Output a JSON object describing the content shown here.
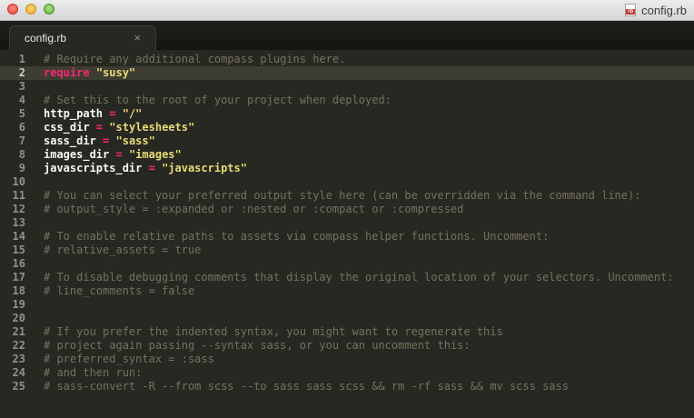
{
  "window": {
    "title": "config.rb",
    "file_icon_text": "rb"
  },
  "tabs": [
    {
      "label": "config.rb",
      "close": "×",
      "active": true
    }
  ],
  "editor": {
    "current_line": 2,
    "lines": [
      {
        "n": "1",
        "tokens": [
          {
            "t": "comment",
            "v": "# Require any additional compass plugins here."
          }
        ]
      },
      {
        "n": "2",
        "tokens": [
          {
            "t": "keyword",
            "v": "require"
          },
          {
            "t": "plain",
            "v": " "
          },
          {
            "t": "string",
            "v": "\"susy\""
          }
        ]
      },
      {
        "n": "3",
        "tokens": []
      },
      {
        "n": "4",
        "tokens": [
          {
            "t": "comment",
            "v": "# Set this to the root of your project when deployed:"
          }
        ]
      },
      {
        "n": "5",
        "tokens": [
          {
            "t": "plain",
            "v": "http_path "
          },
          {
            "t": "op",
            "v": "="
          },
          {
            "t": "plain",
            "v": " "
          },
          {
            "t": "string",
            "v": "\"/\""
          }
        ]
      },
      {
        "n": "6",
        "tokens": [
          {
            "t": "plain",
            "v": "css_dir "
          },
          {
            "t": "op",
            "v": "="
          },
          {
            "t": "plain",
            "v": " "
          },
          {
            "t": "string",
            "v": "\"stylesheets\""
          }
        ]
      },
      {
        "n": "7",
        "tokens": [
          {
            "t": "plain",
            "v": "sass_dir "
          },
          {
            "t": "op",
            "v": "="
          },
          {
            "t": "plain",
            "v": " "
          },
          {
            "t": "string",
            "v": "\"sass\""
          }
        ]
      },
      {
        "n": "8",
        "tokens": [
          {
            "t": "plain",
            "v": "images_dir "
          },
          {
            "t": "op",
            "v": "="
          },
          {
            "t": "plain",
            "v": " "
          },
          {
            "t": "string",
            "v": "\"images\""
          }
        ]
      },
      {
        "n": "9",
        "tokens": [
          {
            "t": "plain",
            "v": "javascripts_dir "
          },
          {
            "t": "op",
            "v": "="
          },
          {
            "t": "plain",
            "v": " "
          },
          {
            "t": "string",
            "v": "\"javascripts\""
          }
        ]
      },
      {
        "n": "10",
        "tokens": []
      },
      {
        "n": "11",
        "tokens": [
          {
            "t": "comment",
            "v": "# You can select your preferred output style here (can be overridden via the command line):"
          }
        ]
      },
      {
        "n": "12",
        "tokens": [
          {
            "t": "comment",
            "v": "# output_style = :expanded or :nested or :compact or :compressed"
          }
        ]
      },
      {
        "n": "13",
        "tokens": []
      },
      {
        "n": "14",
        "tokens": [
          {
            "t": "comment",
            "v": "# To enable relative paths to assets via compass helper functions. Uncomment:"
          }
        ]
      },
      {
        "n": "15",
        "tokens": [
          {
            "t": "comment",
            "v": "# relative_assets = true"
          }
        ]
      },
      {
        "n": "16",
        "tokens": []
      },
      {
        "n": "17",
        "tokens": [
          {
            "t": "comment",
            "v": "# To disable debugging comments that display the original location of your selectors. Uncomment:"
          }
        ]
      },
      {
        "n": "18",
        "tokens": [
          {
            "t": "comment",
            "v": "# line_comments = false"
          }
        ]
      },
      {
        "n": "19",
        "tokens": []
      },
      {
        "n": "20",
        "tokens": []
      },
      {
        "n": "21",
        "tokens": [
          {
            "t": "comment",
            "v": "# If you prefer the indented syntax, you might want to regenerate this"
          }
        ]
      },
      {
        "n": "22",
        "tokens": [
          {
            "t": "comment",
            "v": "# project again passing --syntax sass, or you can uncomment this:"
          }
        ]
      },
      {
        "n": "23",
        "tokens": [
          {
            "t": "comment",
            "v": "# preferred_syntax = :sass"
          }
        ]
      },
      {
        "n": "24",
        "tokens": [
          {
            "t": "comment",
            "v": "# and then run:"
          }
        ]
      },
      {
        "n": "25",
        "tokens": [
          {
            "t": "comment",
            "v": "# sass-convert -R --from scss --to sass sass scss && rm -rf sass && mv scss sass"
          }
        ]
      }
    ]
  }
}
